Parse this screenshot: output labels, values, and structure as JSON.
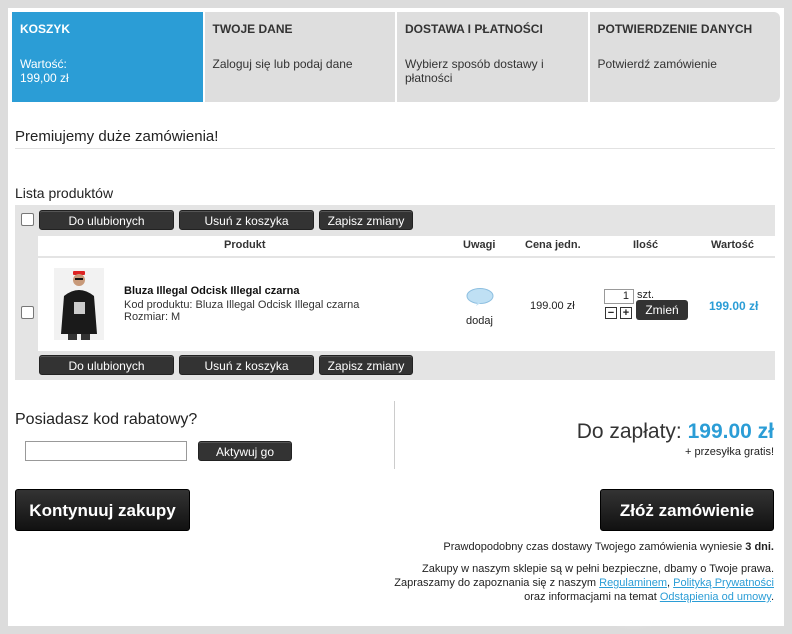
{
  "steps": [
    {
      "title": "KOSZYK",
      "desc": "Wartość:\n199,00 zł",
      "active": true
    },
    {
      "title": "TWOJE DANE",
      "desc": "Zaloguj się lub podaj dane"
    },
    {
      "title": "DOSTAWA I PŁATNOŚCI",
      "desc": "Wybierz sposób dostawy i płatności"
    },
    {
      "title": "POTWIERDZENIE DANYCH",
      "desc": "Potwierdź zamówienie"
    }
  ],
  "promo": "Premiujemy duże zamówienia!",
  "list_title": "Lista produktów",
  "actions": {
    "favorites": "Do ulubionych",
    "remove": "Usuń z koszyka",
    "save": "Zapisz zmiany"
  },
  "table": {
    "headers": {
      "product": "Produkt",
      "notes": "Uwagi",
      "unit_price": "Cena jedn.",
      "qty": "Ilość",
      "value": "Wartość"
    },
    "row": {
      "name": "Bluza Illegal Odcisk Illegal czarna",
      "code": "Kod produktu: Bluza Illegal Odcisk Illegal czarna",
      "size": "Rozmiar: M",
      "note_label": "dodaj",
      "price": "199.00 zł",
      "qty": "1",
      "unit": "szt.",
      "change": "Zmień",
      "value": "199.00 zł"
    }
  },
  "coupon": {
    "title": "Posiadasz kod rabatowy?",
    "button": "Aktywuj go",
    "value": ""
  },
  "total": {
    "label": "Do zapłaty:",
    "amount": "199.00 zł",
    "shipping": "+ przesyłka gratis!"
  },
  "continue_button": "Kontynuuj zakupy",
  "order_button": "Złóż zamówienie",
  "delivery_note_pre": "Prawdopodobny czas dostawy Twojego zamówienia wyniesie",
  "delivery_days": "3 dni.",
  "safety_line": "Zakupy w naszym sklepie są w pełni bezpieczne, dbamy o Twoje prawa.",
  "invite_pre": "Zapraszamy do zapoznania się z naszym",
  "link_terms": "Regulaminem",
  "link_privacy": "Polityką Prywatności",
  "info_pre": "oraz informacjami na temat",
  "link_withdrawal": "Odstąpienia od umowy",
  "colors": {
    "accent": "#2b9dd6",
    "dark_button": "#333333"
  }
}
